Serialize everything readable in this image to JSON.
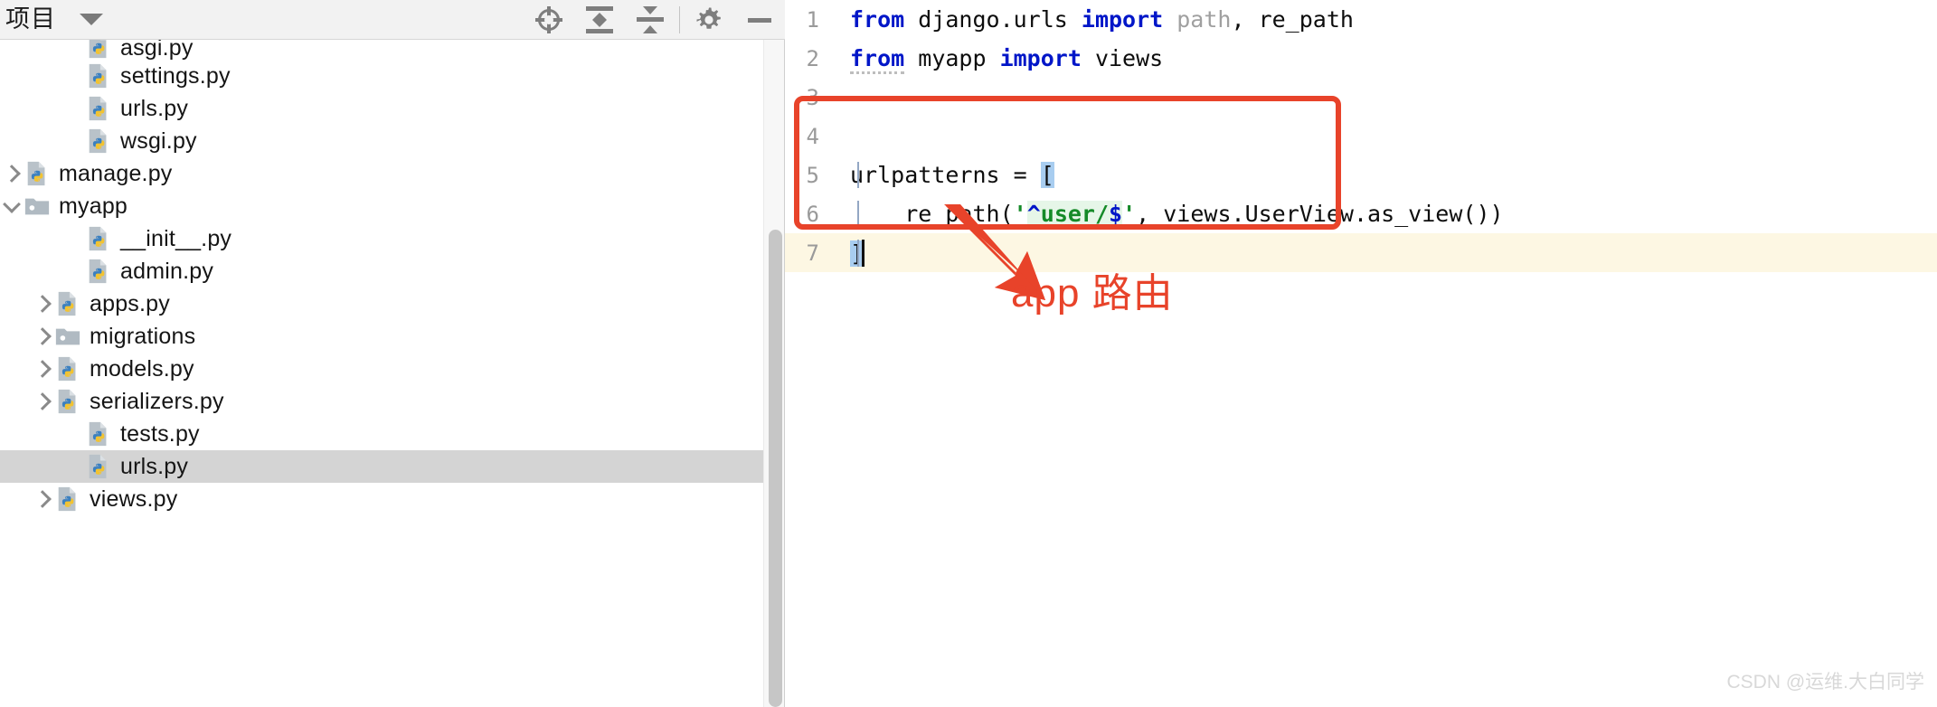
{
  "panel": {
    "title": "项目",
    "dropdown_icon": "chevron-down-icon",
    "tools": [
      {
        "name": "locate-file-button",
        "icon": "crosshair-icon",
        "label": ""
      },
      {
        "name": "expand-all-button",
        "icon": "expand-all-icon",
        "label": ""
      },
      {
        "name": "collapse-all-button",
        "icon": "collapse-all-icon",
        "label": ""
      },
      {
        "name": "settings-button",
        "icon": "gear-icon",
        "label": ""
      },
      {
        "name": "hide-panel-button",
        "icon": "minimize-icon",
        "label": ""
      }
    ]
  },
  "tree": {
    "items": [
      {
        "label": "asgi.py",
        "icon": "python-file-icon",
        "indent": 3,
        "arrow": "none",
        "selected": false,
        "clipped": true
      },
      {
        "label": "settings.py",
        "icon": "python-file-icon",
        "indent": 3,
        "arrow": "none",
        "selected": false
      },
      {
        "label": "urls.py",
        "icon": "python-file-icon",
        "indent": 3,
        "arrow": "none",
        "selected": false
      },
      {
        "label": "wsgi.py",
        "icon": "python-file-icon",
        "indent": 3,
        "arrow": "none",
        "selected": false
      },
      {
        "label": "manage.py",
        "icon": "python-file-icon",
        "indent": 1,
        "arrow": "collapsed",
        "selected": false
      },
      {
        "label": "myapp",
        "icon": "package-folder-icon",
        "indent": 1,
        "arrow": "expanded",
        "selected": false
      },
      {
        "label": "__init__.py",
        "icon": "python-file-icon",
        "indent": 3,
        "arrow": "none",
        "selected": false
      },
      {
        "label": "admin.py",
        "icon": "python-file-icon",
        "indent": 3,
        "arrow": "none",
        "selected": false
      },
      {
        "label": "apps.py",
        "icon": "python-file-icon",
        "indent": 2,
        "arrow": "collapsed",
        "selected": false
      },
      {
        "label": "migrations",
        "icon": "package-folder-icon",
        "indent": 2,
        "arrow": "collapsed",
        "selected": false
      },
      {
        "label": "models.py",
        "icon": "python-file-icon",
        "indent": 2,
        "arrow": "collapsed",
        "selected": false
      },
      {
        "label": "serializers.py",
        "icon": "python-file-icon",
        "indent": 2,
        "arrow": "collapsed",
        "selected": false
      },
      {
        "label": "tests.py",
        "icon": "python-file-icon",
        "indent": 3,
        "arrow": "none",
        "selected": false
      },
      {
        "label": "urls.py",
        "icon": "python-file-icon",
        "indent": 3,
        "arrow": "none",
        "selected": true
      },
      {
        "label": "views.py",
        "icon": "python-file-icon",
        "indent": 2,
        "arrow": "collapsed",
        "selected": false
      }
    ]
  },
  "editor": {
    "lines": [
      {
        "n": "1",
        "current": false
      },
      {
        "n": "2",
        "current": false
      },
      {
        "n": "3",
        "current": false
      },
      {
        "n": "4",
        "current": false
      },
      {
        "n": "5",
        "current": false
      },
      {
        "n": "6",
        "current": false
      },
      {
        "n": "7",
        "current": true
      }
    ],
    "code": {
      "l1_kw_from": "from",
      "l1_module": " django.urls ",
      "l1_kw_import": "import",
      "l1_path": " path",
      "l1_comma": ", ",
      "l1_repath": "re_path",
      "l2_kw_from": "from",
      "l2_module": " myapp ",
      "l2_kw_import": "import",
      "l2_views": " views",
      "l5_name": "urlpatterns = ",
      "l5_bracket": "[",
      "l6_indent": "    ",
      "l6_call": "re_path(",
      "l6_q1": "'",
      "l6_caret": "^",
      "l6_body": "user/",
      "l6_dollar": "$",
      "l6_q2": "'",
      "l6_rest": ", views.UserView.as_view())",
      "l7_bracket": "]"
    }
  },
  "annotation": {
    "text": "app 路由",
    "color": "#e8432a",
    "shape": "rounded-rectangle-with-arrow"
  },
  "watermark": {
    "text": "CSDN @运维.大白同学"
  },
  "colors": {
    "panel_header_bg": "#f2f2f2",
    "selection_bg": "#d4d4d4",
    "current_line_bg": "#fdf7e3",
    "keyword": "#0016c8",
    "string": "#158a28",
    "unused": "#a0a0a0",
    "bracket_match": "#a8cdf0",
    "annotation_red": "#e8432a",
    "scrollbar_thumb": "#c6c6c6"
  }
}
